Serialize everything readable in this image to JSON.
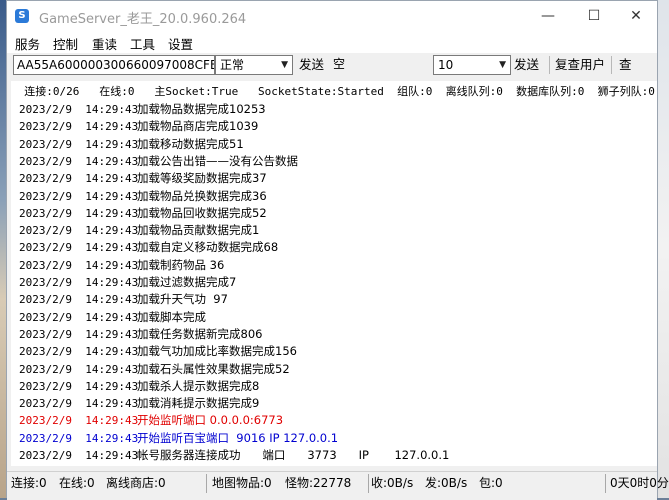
{
  "window": {
    "title": "GameServer_老王_20.0.960.264",
    "icon": "app-s-icon",
    "controls": {
      "minimize": "—",
      "maximize": "☐",
      "close": "✕"
    }
  },
  "menu": [
    "服务",
    "控制",
    "重读",
    "工具",
    "设置"
  ],
  "toolbar": {
    "id_value": "AA55A600000300660097008CFB!",
    "mode_select": "正常",
    "send1_label": "发送",
    "message_value": "空",
    "count_select": "10",
    "send2_label": "发送",
    "reset_user_label": "复查用户",
    "check_label": "查"
  },
  "status_summary": "  连接:0/26   在线:0   主Socket:True   SocketState:Started  组队:0  离线队列:0  数据库队列:0  狮子列队:0",
  "log": [
    {
      "date": "2023/2/9  14:29:43",
      "msg": "加载物品数据完成10253",
      "color": "normal"
    },
    {
      "date": "2023/2/9  14:29:43",
      "msg": "加载物品商店完成1039",
      "color": "normal"
    },
    {
      "date": "2023/2/9  14:29:43",
      "msg": "加载移动数据完成51",
      "color": "normal"
    },
    {
      "date": "2023/2/9  14:29:43",
      "msg": "加载公告出错——没有公告数据",
      "color": "normal"
    },
    {
      "date": "2023/2/9  14:29:43",
      "msg": "加载等级奖励数据完成37",
      "color": "normal"
    },
    {
      "date": "2023/2/9  14:29:43",
      "msg": "加载物品兑换数据完成36",
      "color": "normal"
    },
    {
      "date": "2023/2/9  14:29:43",
      "msg": "加载物品回收数据完成52",
      "color": "normal"
    },
    {
      "date": "2023/2/9  14:29:43",
      "msg": "加载物品贡献数据完成1",
      "color": "normal"
    },
    {
      "date": "2023/2/9  14:29:43",
      "msg": "加载自定义移动数据完成68",
      "color": "normal"
    },
    {
      "date": "2023/2/9  14:29:43",
      "msg": "加载制药物品 36",
      "color": "normal"
    },
    {
      "date": "2023/2/9  14:29:43",
      "msg": "加载过滤数据完成7",
      "color": "normal"
    },
    {
      "date": "2023/2/9  14:29:43",
      "msg": "加载升天气功  97",
      "color": "normal"
    },
    {
      "date": "2023/2/9  14:29:43",
      "msg": "加载脚本完成",
      "color": "normal"
    },
    {
      "date": "2023/2/9  14:29:43",
      "msg": "加载任务数据新完成806",
      "color": "normal"
    },
    {
      "date": "2023/2/9  14:29:43",
      "msg": "加载气功加成比率数据完成156",
      "color": "normal"
    },
    {
      "date": "2023/2/9  14:29:43",
      "msg": "加载石头属性效果数据完成52",
      "color": "normal"
    },
    {
      "date": "2023/2/9  14:29:43",
      "msg": "加载杀人提示数据完成8",
      "color": "normal"
    },
    {
      "date": "2023/2/9  14:29:43",
      "msg": "加载消耗提示数据完成9",
      "color": "normal"
    },
    {
      "date": "2023/2/9  14:29:43",
      "msg": "开始监听端口 0.0.0.0:6773",
      "color": "red"
    },
    {
      "date": "2023/2/9  14:29:43",
      "msg": "开始监听百宝端口  9016 IP 127.0.0.1",
      "color": "blue"
    },
    {
      "date": "2023/2/9  14:29:43",
      "msg": "帐号服务器连接成功      端口      3773      IP       127.0.0.1",
      "color": "normal"
    }
  ],
  "statusbar": {
    "connections": "连接:0",
    "online": "在线:0",
    "offline_shop": "离线商店:0",
    "map_items": "地图物品:0",
    "monsters": "怪物:22778",
    "recv": "收:0B/s",
    "send": "发:0B/s",
    "packets": "包:0",
    "uptime": "0天0时0分30"
  },
  "colors": {
    "red": "#e00000",
    "blue": "#0000d0",
    "accent": "#2b7ad8"
  }
}
